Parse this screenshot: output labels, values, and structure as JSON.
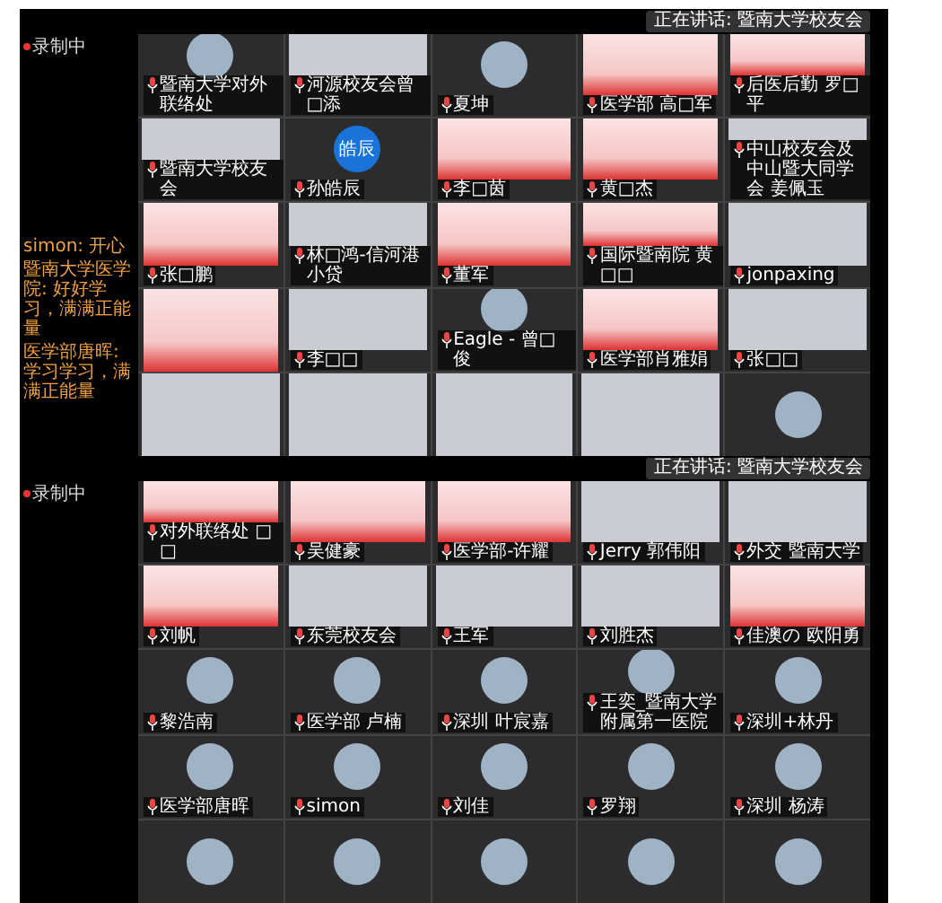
{
  "screens": [
    {
      "recording": "录制中",
      "speaker": "正在讲话: 暨南大学校友会",
      "chat": [
        {
          "text": "simon: 开心"
        },
        {
          "text": "暨南大学医学院: 好好学习，满满正能量"
        },
        {
          "text": "医学部唐晖: 学习学习，满满正能量"
        }
      ],
      "tiles": [
        {
          "kind": "avatar",
          "name": "暨南大学对外联络处"
        },
        {
          "kind": "video",
          "name": "河源校友会曾□添"
        },
        {
          "kind": "avatar",
          "name": "夏坤"
        },
        {
          "kind": "banner",
          "name": "医学部 高□军"
        },
        {
          "kind": "banner",
          "name": "后医后勤 罗□平"
        },
        {
          "kind": "video",
          "name": "暨南大学校友会"
        },
        {
          "kind": "initials",
          "initials": "皓辰",
          "name": "孙皓辰"
        },
        {
          "kind": "banner",
          "name": "李□茵"
        },
        {
          "kind": "banner",
          "name": "黄□杰"
        },
        {
          "kind": "video",
          "name": "中山校友会及中山暨大同学会 姜佩玉"
        },
        {
          "kind": "banner",
          "name": "张□鹏"
        },
        {
          "kind": "video",
          "name": "林□鸿-信河港小贷"
        },
        {
          "kind": "banner",
          "name": "董军"
        },
        {
          "kind": "banner",
          "name": "国际暨南院 黄□□"
        },
        {
          "kind": "video",
          "name": "jonpaxing"
        },
        {
          "kind": "banner"
        },
        {
          "kind": "video",
          "name": "李□□"
        },
        {
          "kind": "avatar",
          "name": "Eagle - 曾□俊"
        },
        {
          "kind": "banner",
          "name": "医学部肖雅娟"
        },
        {
          "kind": "video",
          "name": "张□□"
        },
        {
          "kind": "video"
        },
        {
          "kind": "video"
        },
        {
          "kind": "video"
        },
        {
          "kind": "video"
        },
        {
          "kind": "avatar"
        }
      ]
    },
    {
      "recording": "录制中",
      "speaker": "正在讲话: 暨南大学校友会",
      "tiles": [
        {
          "kind": "banner",
          "name": "对外联络处 □□"
        },
        {
          "kind": "banner",
          "name": "吴健豪"
        },
        {
          "kind": "banner",
          "name": "医学部-许耀"
        },
        {
          "kind": "video",
          "name": "Jerry 郭伟阳"
        },
        {
          "kind": "video",
          "name": "外交 暨南大学"
        },
        {
          "kind": "banner",
          "name": "刘帆"
        },
        {
          "kind": "video",
          "name": "东莞校友会"
        },
        {
          "kind": "video",
          "name": "王军"
        },
        {
          "kind": "video",
          "name": "刘胜杰"
        },
        {
          "kind": "banner",
          "name": "佳澳の 欧阳勇"
        },
        {
          "kind": "avatar",
          "name": "黎浩南"
        },
        {
          "kind": "avatar",
          "name": "医学部 卢楠"
        },
        {
          "kind": "avatar",
          "name": "深圳 叶宸嘉"
        },
        {
          "kind": "avatar",
          "name": "王奕_暨南大学附属第一医院"
        },
        {
          "kind": "avatar",
          "name": "深圳+林丹"
        },
        {
          "kind": "avatar",
          "name": "医学部唐晖"
        },
        {
          "kind": "avatar",
          "name": "simon"
        },
        {
          "kind": "avatar",
          "name": "刘佳"
        },
        {
          "kind": "avatar",
          "name": "罗翔"
        },
        {
          "kind": "avatar",
          "name": "深圳 杨涛"
        },
        {
          "kind": "avatar"
        },
        {
          "kind": "avatar"
        },
        {
          "kind": "avatar"
        },
        {
          "kind": "avatar"
        },
        {
          "kind": "avatar"
        }
      ]
    }
  ]
}
